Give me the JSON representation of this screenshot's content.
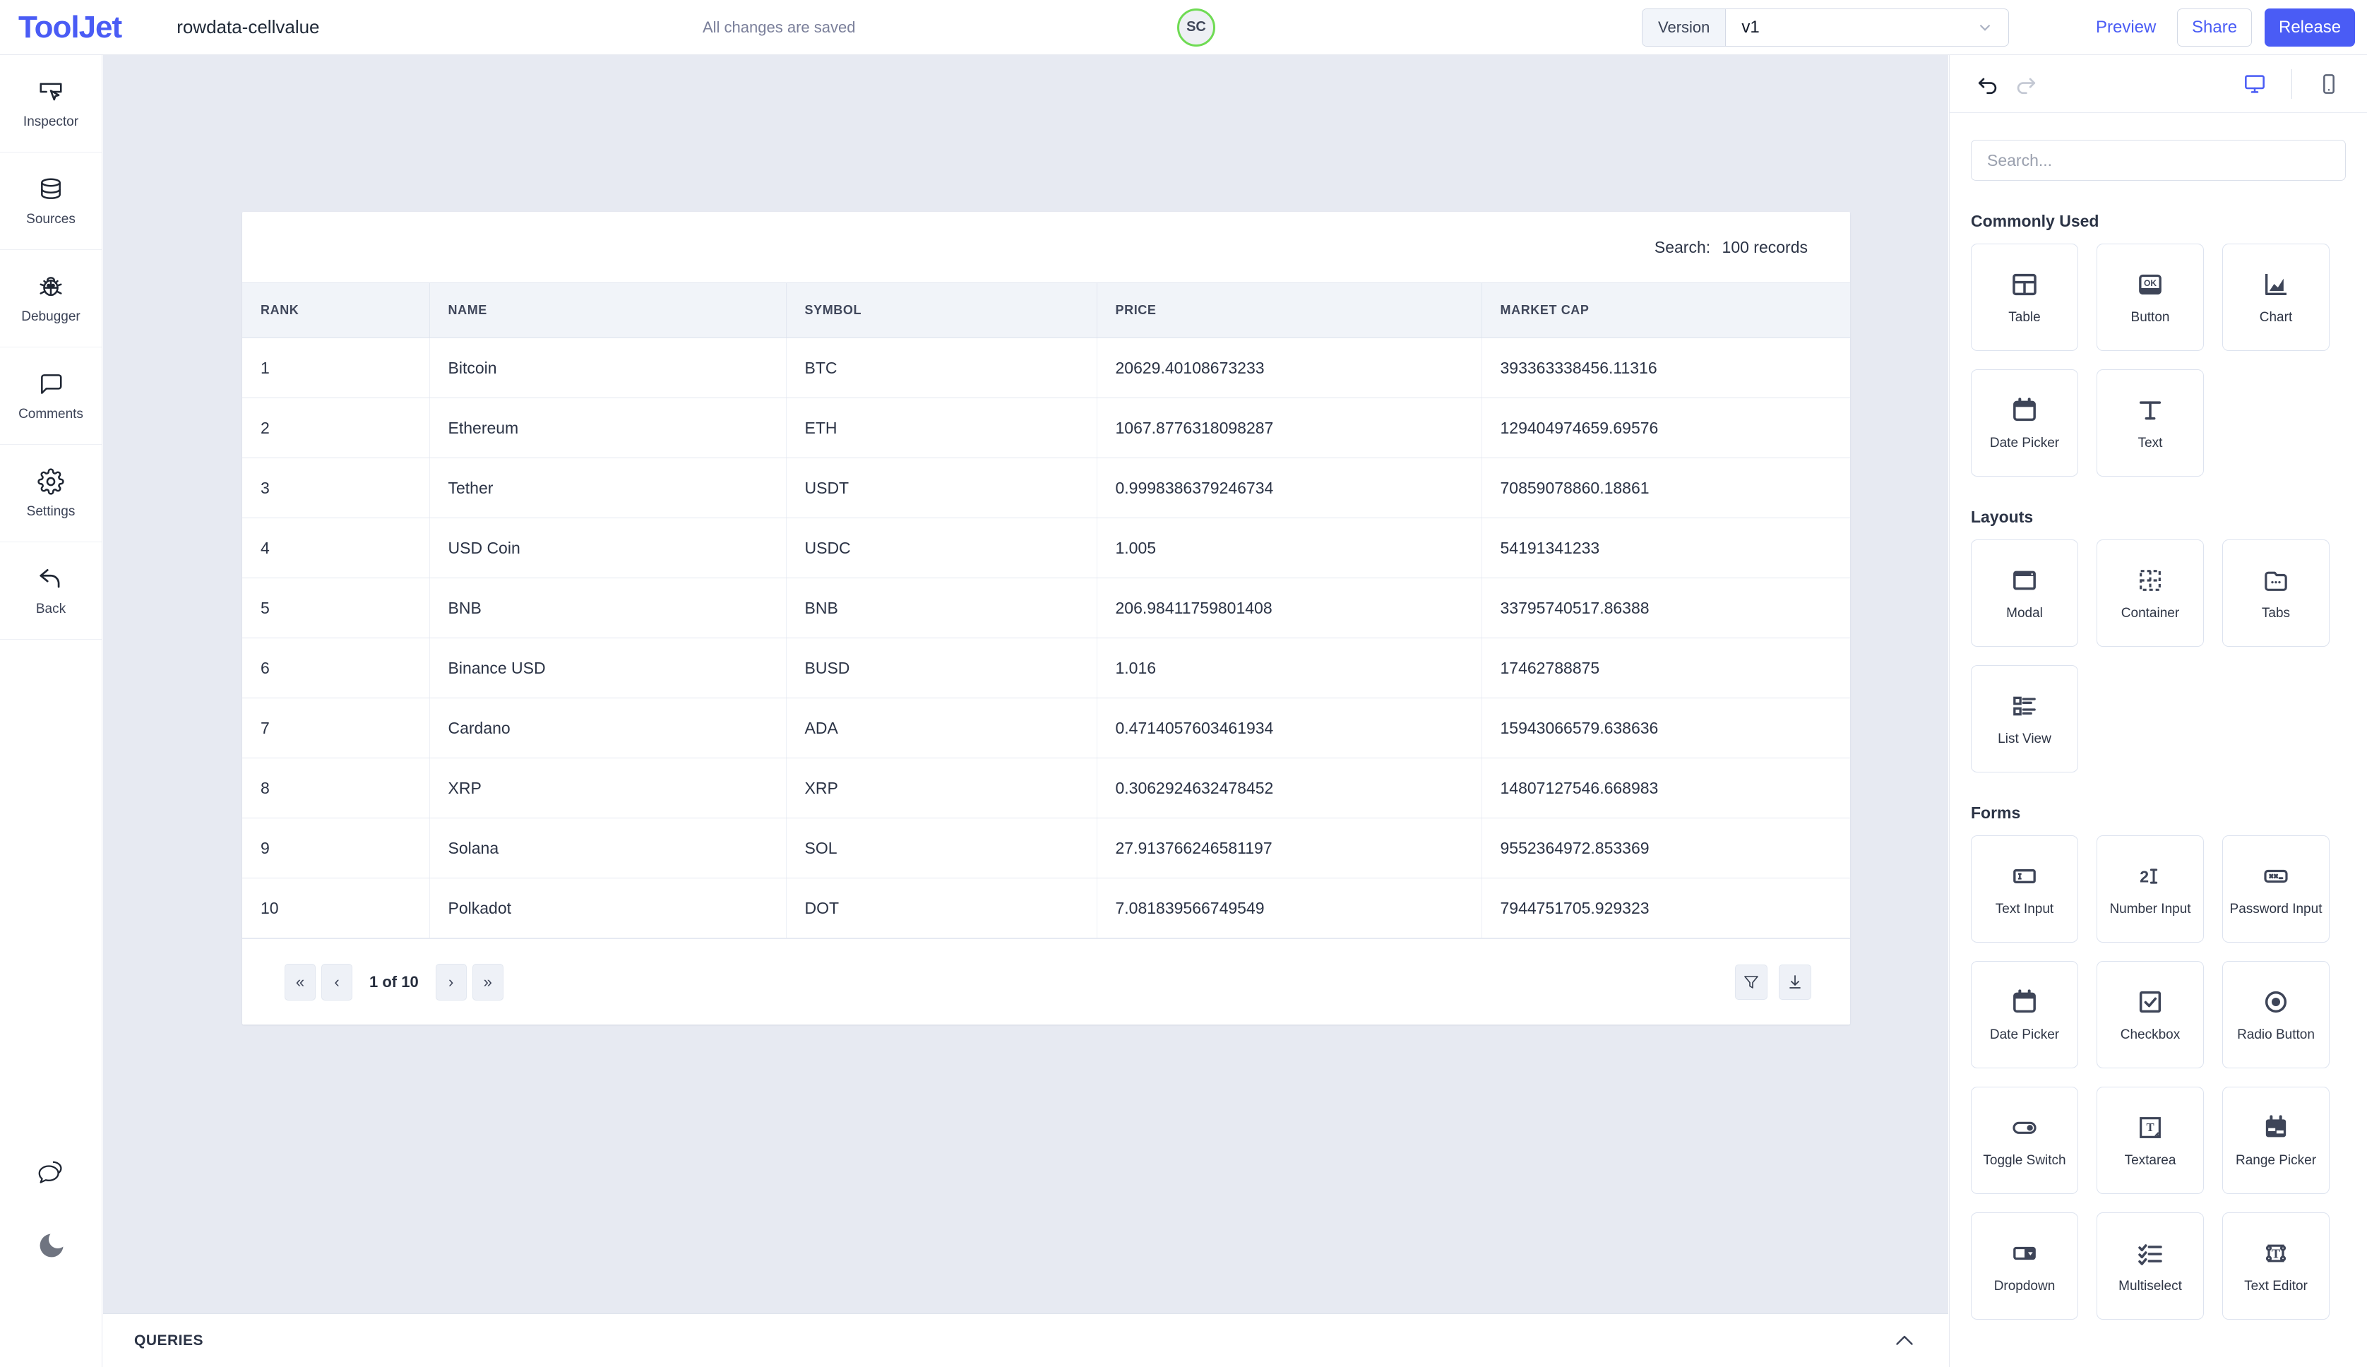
{
  "topbar": {
    "brand": "ToolJet",
    "app_name": "rowdata-cellvalue",
    "save_status": "All changes are saved",
    "avatar_initials": "SC",
    "avatar_ring_color": "#6fdb53",
    "version_label": "Version",
    "version_value": "v1",
    "preview_label": "Preview",
    "share_label": "Share",
    "release_label": "Release",
    "accent_color": "#4a5cf5"
  },
  "sidebar": {
    "items": [
      {
        "label": "Inspector",
        "icon": "inspector-icon"
      },
      {
        "label": "Sources",
        "icon": "database-icon"
      },
      {
        "label": "Debugger",
        "icon": "bug-icon"
      },
      {
        "label": "Comments",
        "icon": "comment-icon"
      },
      {
        "label": "Settings",
        "icon": "gear-icon"
      },
      {
        "label": "Back",
        "icon": "back-arrow-icon"
      }
    ],
    "bottom_icons": [
      "chat-bubbles-icon",
      "moon-icon"
    ]
  },
  "table_widget": {
    "search_label": "Search:",
    "records_text": "100 records",
    "columns": [
      "RANK",
      "NAME",
      "SYMBOL",
      "PRICE",
      "MARKET CAP"
    ],
    "rows": [
      [
        "1",
        "Bitcoin",
        "BTC",
        "20629.40108673233",
        "393363338456.11316"
      ],
      [
        "2",
        "Ethereum",
        "ETH",
        "1067.8776318098287",
        "129404974659.69576"
      ],
      [
        "3",
        "Tether",
        "USDT",
        "0.9998386379246734",
        "70859078860.18861"
      ],
      [
        "4",
        "USD Coin",
        "USDC",
        "1.005",
        "54191341233"
      ],
      [
        "5",
        "BNB",
        "BNB",
        "206.98411759801408",
        "33795740517.86388"
      ],
      [
        "6",
        "Binance USD",
        "BUSD",
        "1.016",
        "17462788875"
      ],
      [
        "7",
        "Cardano",
        "ADA",
        "0.4714057603461934",
        "15943066579.638636"
      ],
      [
        "8",
        "XRP",
        "XRP",
        "0.3062924632478452",
        "14807127546.668983"
      ],
      [
        "9",
        "Solana",
        "SOL",
        "27.913766246581197",
        "9552364972.853369"
      ],
      [
        "10",
        "Polkadot",
        "DOT",
        "7.081839566749549",
        "7944751705.929323"
      ]
    ],
    "pagination": {
      "first_label": "«",
      "prev_label": "‹",
      "page_info": "1 of 10",
      "next_label": "›",
      "last_label": "»"
    },
    "footer_icons": [
      "filter-icon",
      "download-icon"
    ]
  },
  "queries_bar": {
    "title": "QUERIES",
    "chevron": "chevron-up-icon"
  },
  "right_panel": {
    "toolbar": {
      "undo_icon": "undo-icon",
      "redo_icon": "redo-icon",
      "desktop_icon": "desktop-icon",
      "mobile_icon": "mobile-icon",
      "active_view": "desktop",
      "active_color": "#4a5cf5"
    },
    "search_placeholder": "Search...",
    "sections": [
      {
        "title": "Commonly Used",
        "components": [
          {
            "label": "Table",
            "icon": "table-icon"
          },
          {
            "label": "Button",
            "icon": "ok-button-icon"
          },
          {
            "label": "Chart",
            "icon": "chart-icon"
          },
          {
            "label": "Date Picker",
            "icon": "calendar-icon"
          },
          {
            "label": "Text",
            "icon": "text-t-icon"
          }
        ]
      },
      {
        "title": "Layouts",
        "components": [
          {
            "label": "Modal",
            "icon": "window-icon"
          },
          {
            "label": "Container",
            "icon": "dashed-grid-icon"
          },
          {
            "label": "Tabs",
            "icon": "tabs-icon"
          },
          {
            "label": "List View",
            "icon": "list-view-icon"
          }
        ]
      },
      {
        "title": "Forms",
        "components": [
          {
            "label": "Text Input",
            "icon": "text-input-icon"
          },
          {
            "label": "Number Input",
            "icon": "number-input-icon"
          },
          {
            "label": "Password Input",
            "icon": "password-input-icon"
          },
          {
            "label": "Date Picker",
            "icon": "calendar-icon"
          },
          {
            "label": "Checkbox",
            "icon": "checkbox-icon"
          },
          {
            "label": "Radio Button",
            "icon": "radio-button-icon"
          },
          {
            "label": "Toggle Switch",
            "icon": "toggle-switch-icon"
          },
          {
            "label": "Textarea",
            "icon": "textarea-icon"
          },
          {
            "label": "Range Picker",
            "icon": "range-picker-icon"
          },
          {
            "label": "Dropdown",
            "icon": "dropdown-icon"
          },
          {
            "label": "Multiselect",
            "icon": "multiselect-icon"
          },
          {
            "label": "Text Editor",
            "icon": "text-editor-icon"
          }
        ]
      }
    ]
  }
}
